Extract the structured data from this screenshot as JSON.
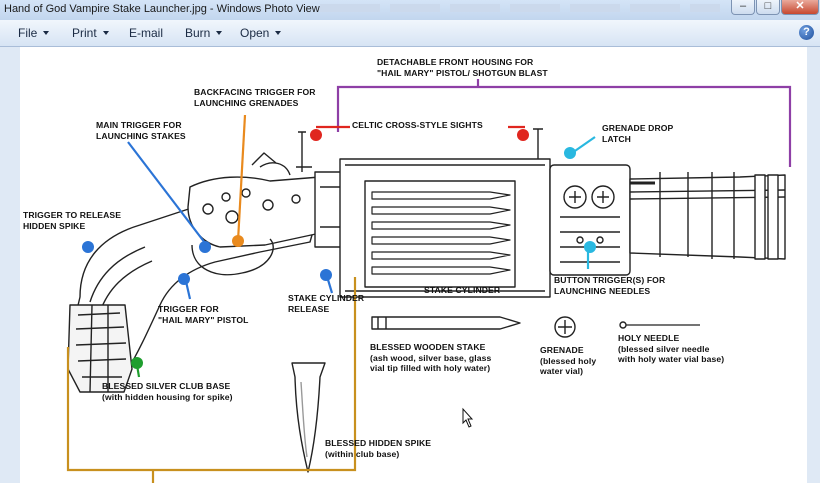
{
  "window": {
    "title": "Hand of God Vampire Stake Launcher.jpg - Windows Photo Viewer",
    "minimize_glyph": "–",
    "maximize_glyph": "□",
    "close_glyph": "✕"
  },
  "menu": {
    "file": "File",
    "print": "Print",
    "email": "E-mail",
    "burn": "Burn",
    "open": "Open"
  },
  "help_glyph": "?",
  "image": {
    "labels": {
      "front_housing": "DETACHABLE FRONT HOUSING FOR\n\"HAIL MARY\" PISTOL/ SHOTGUN BLAST",
      "backfacing_trigger": "BACKFACING TRIGGER FOR\nLAUNCHING GRENADES",
      "main_trigger": "MAIN TRIGGER FOR\nLAUNCHING STAKES",
      "celtic_sights": "CELTIC CROSS-STYLE SIGHTS",
      "grenade_latch": "GRENADE DROP\nLATCH",
      "spike_trigger": "TRIGGER TO RELEASE\nHIDDEN SPIKE",
      "button_triggers": "BUTTON TRIGGER(S) FOR\nLAUNCHING NEEDLES",
      "stake_cylinder": "STAKE CYLINDER",
      "stake_release": "STAKE CYLINDER\nRELEASE",
      "hail_mary_trigger": "TRIGGER FOR\n\"HAIL MARY\" PISTOL",
      "wooden_stake": "BLESSED WOODEN STAKE\n(ash wood, silver base, glass\nvial tip filled with holy water)",
      "grenade": "GRENADE\n(blessed holy\nwater vial)",
      "holy_needle": "HOLY NEEDLE\n(blessed silver needle\nwith holy water vial base)",
      "club_base": "BLESSED SILVER CLUB BASE\n(with hidden housing for spike)",
      "hidden_spike": "BLESSED HIDDEN SPIKE\n(within club base)"
    }
  },
  "colors": {
    "frame_bg": "#dfe9f5",
    "purple": "#8e3fa6",
    "orange": "#e98a1e",
    "blue": "#2b74d6",
    "red": "#e0261f",
    "cyan": "#29b8e0",
    "green": "#1f9e2e",
    "gold": "#c8901e"
  },
  "icons": {
    "help": "help-icon",
    "caret": "dropdown-caret-icon",
    "cursor": "mouse-cursor-icon"
  }
}
